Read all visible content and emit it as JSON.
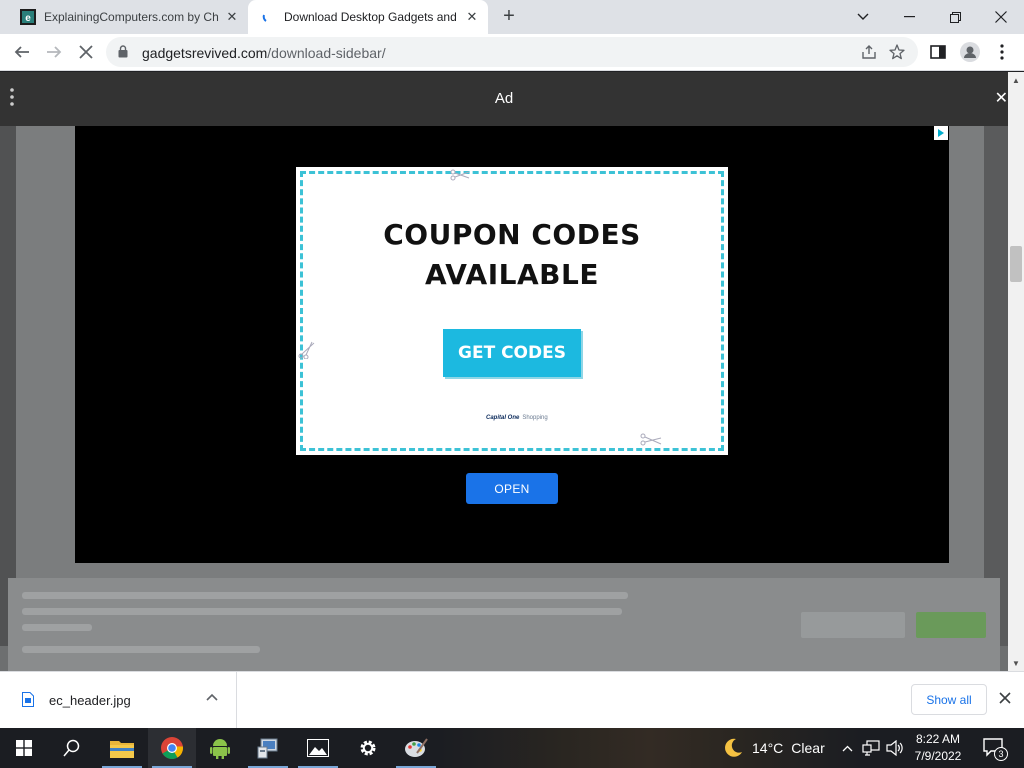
{
  "browser": {
    "tabs": [
      {
        "title": "ExplainingComputers.com by Ch",
        "active": false
      },
      {
        "title": "Download Desktop Gadgets and",
        "active": true
      }
    ],
    "address": {
      "domain": "gadgetsrevived.com",
      "path": "/download-sidebar/"
    }
  },
  "page": {
    "ad_header": {
      "label": "Ad"
    },
    "ad": {
      "title_line1": "COUPON CODES",
      "title_line2": "AVAILABLE",
      "cta": "GET CODES",
      "logo_brand": "Capital One",
      "logo_sub": "Shopping",
      "open_button": "OPEN"
    }
  },
  "downloads": {
    "file_name": "ec_header.jpg",
    "show_all": "Show all"
  },
  "taskbar": {
    "weather": {
      "temp": "14°C",
      "condition": "Clear"
    },
    "clock": {
      "time": "8:22 AM",
      "date": "7/9/2022"
    },
    "notification_count": "3"
  },
  "colors": {
    "accent_blue": "#1a73e8",
    "coupon_cyan": "#1cb9e0",
    "coupon_border": "#3cc2d6"
  }
}
